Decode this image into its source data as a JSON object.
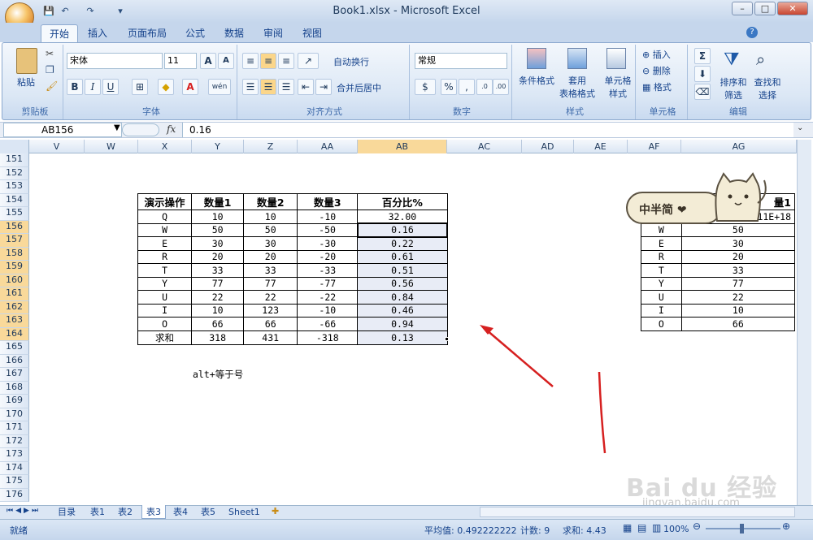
{
  "window": {
    "title": "Book1.xlsx - Microsoft Excel",
    "min": "–",
    "max": "□",
    "close": "✕"
  },
  "quick_access": {
    "save": "💾",
    "undo": "↶",
    "redo": "↷",
    "customize": "▾"
  },
  "tabs": [
    "开始",
    "插入",
    "页面布局",
    "公式",
    "数据",
    "审阅",
    "视图"
  ],
  "ribbon": {
    "clipboard": {
      "paste": "粘贴",
      "label": "剪贴板"
    },
    "font": {
      "name": "宋体",
      "size": "11",
      "grow": "A",
      "shrink": "A",
      "bold": "B",
      "italic": "I",
      "underline": "U",
      "label": "字体",
      "wen": "wén"
    },
    "alignment": {
      "wrap": "自动换行",
      "merge": "合并后居中",
      "label": "对齐方式"
    },
    "number": {
      "format": "常规",
      "percent": "%",
      "comma": ",",
      "label": "数字"
    },
    "styles": {
      "conditional": "条件格式",
      "table1": "套用",
      "table2": "表格格式",
      "cell1": "单元格",
      "cell2": "样式",
      "label": "样式"
    },
    "cells": {
      "insert": "插入",
      "delete": "删除",
      "format": "格式",
      "label": "单元格"
    },
    "editing": {
      "sigma": "Σ",
      "sort1": "排序和",
      "sort2": "筛选",
      "find1": "查找和",
      "find2": "选择",
      "label": "编辑"
    }
  },
  "formula_bar": {
    "name_box": "AB156",
    "fx": "fx",
    "value": "0.16"
  },
  "columns": [
    "V",
    "W",
    "X",
    "Y",
    "Z",
    "AA",
    "AB",
    "AC",
    "AD",
    "AE",
    "AF",
    "AG"
  ],
  "rows": [
    "151",
    "152",
    "153",
    "154",
    "155",
    "156",
    "157",
    "158",
    "159",
    "160",
    "161",
    "162",
    "163",
    "164",
    "165",
    "166",
    "167",
    "168",
    "169",
    "170",
    "171",
    "172",
    "173",
    "174",
    "175",
    "176"
  ],
  "main_table": {
    "headers": [
      "演示操作",
      "数量1",
      "数量2",
      "数量3",
      "百分比%"
    ],
    "rows": [
      [
        "Q",
        "10",
        "10",
        "-10",
        "32.00"
      ],
      [
        "W",
        "50",
        "50",
        "-50",
        "0.16"
      ],
      [
        "E",
        "30",
        "30",
        "-30",
        "0.22"
      ],
      [
        "R",
        "20",
        "20",
        "-20",
        "0.61"
      ],
      [
        "T",
        "33",
        "33",
        "-33",
        "0.51"
      ],
      [
        "Y",
        "77",
        "77",
        "-77",
        "0.56"
      ],
      [
        "U",
        "22",
        "22",
        "-22",
        "0.84"
      ],
      [
        "I",
        "10",
        "123",
        "-10",
        "0.46"
      ],
      [
        "O",
        "66",
        "66",
        "-66",
        "0.94"
      ],
      [
        "求和",
        "318",
        "431",
        "-318",
        "0.13"
      ]
    ]
  },
  "note": "alt+等于号",
  "side_table": {
    "header": "量1",
    "rows": [
      [
        "",
        "11E+18"
      ],
      [
        "W",
        "50"
      ],
      [
        "E",
        "30"
      ],
      [
        "R",
        "20"
      ],
      [
        "T",
        "33"
      ],
      [
        "Y",
        "77"
      ],
      [
        "U",
        "22"
      ],
      [
        "I",
        "10"
      ],
      [
        "O",
        "66"
      ]
    ]
  },
  "sticker": {
    "text": "中半简 ❤"
  },
  "sheets": [
    "目录",
    "表1",
    "表2",
    "表3",
    "表4",
    "表5",
    "Sheet1"
  ],
  "active_sheet": "表3",
  "status": {
    "ready": "就绪",
    "average": "平均值: 0.492222222",
    "count": "计数: 9",
    "sum": "求和: 4.43",
    "zoom": "100%"
  },
  "watermark": {
    "text": "Bai du 经验",
    "url": "jingyan.baidu.com"
  },
  "colors": {
    "accent": "#15428b",
    "arrow": "#d62020",
    "selected_row": "#f9d99a"
  }
}
